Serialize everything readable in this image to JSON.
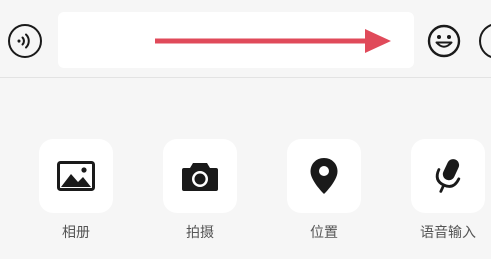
{
  "input_bar": {
    "text_value": "",
    "placeholder": "",
    "voice_icon": "voice-input-icon",
    "emoji_icon": "smiley-face-icon",
    "more_icon": "plus-circle-icon"
  },
  "annotation": {
    "arrow_color": "#e04a5a"
  },
  "panel": {
    "items": [
      {
        "label": "相册",
        "icon": "image-icon"
      },
      {
        "label": "拍摄",
        "icon": "camera-icon"
      },
      {
        "label": "位置",
        "icon": "location-pin-icon"
      },
      {
        "label": "语音输入",
        "icon": "microphone-icon"
      }
    ]
  }
}
